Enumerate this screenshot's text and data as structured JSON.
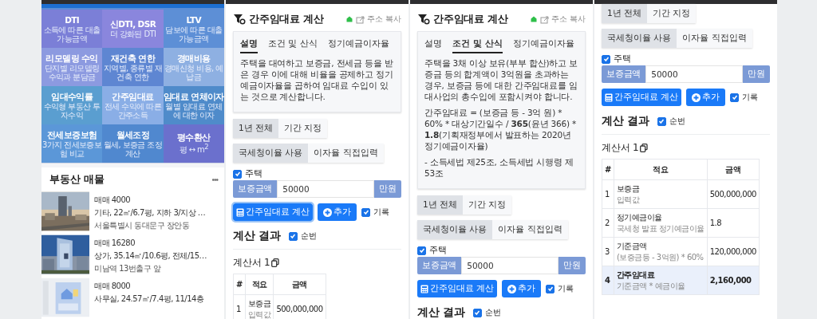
{
  "screens": [
    {
      "blocks": [
        {
          "kind": "tile_grid",
          "tiles": [
            {
              "title": "DTI",
              "subtitle": "소득에 따른 대출 가능금액",
              "color": "#7b7fd7"
            },
            {
              "title": "신DTI, DSR",
              "subtitle": "더 강화된 DTI",
              "color": "#8a86dd"
            },
            {
              "title": "LTV",
              "subtitle": "담보에 따른 대출 가능금액",
              "color": "#5d8fd6"
            },
            {
              "title": "리모델링 수익",
              "subtitle": "단지별 리모델링 수익과 분담금",
              "color": "#8c9ae0"
            },
            {
              "title": "재건축 연한",
              "subtitle": "지역별, 종류별 재건축 연한",
              "color": "#5e86d2"
            },
            {
              "title": "경매비용",
              "subtitle": "경매신청 비용, 예납금",
              "color": "#8eb0e2"
            },
            {
              "title": "임대수익률",
              "subtitle": "수익형 부동산 투자수익",
              "color": "#5a9ed0"
            },
            {
              "title": "간주임대료",
              "subtitle": "전세 수익에 따른 간주소득",
              "color": "#8aaee6"
            },
            {
              "title": "임대료 연체이자",
              "subtitle": "월별 임대료 연체에 대한 이자",
              "color": "#4f8bca"
            },
            {
              "title": "전세보증보험",
              "subtitle": "3가지 전세보증보험 비교",
              "color": "#5b97d8"
            },
            {
              "title": "월세조정",
              "subtitle": "월세, 보증금 조정 계산",
              "color": "#5088cf"
            },
            {
              "title": "평수환산",
              "subtitle": "평 ↔ m$^{2}$",
              "color": "#6b70cd"
            }
          ]
        },
        {
          "kind": "listings",
          "title": "부동산 매물",
          "more": "•••",
          "items": [
            {
              "price": "매매 4000",
              "detail": "기타, 22㎡/6.7평, 지하 3/지상 …",
              "location": "서울특별시 동대문구 장안동"
            },
            {
              "price": "매매 16280",
              "detail": "상가, 35.14㎡/10.6평, 전체/15…",
              "location": "미남역 13번출구 앞"
            },
            {
              "price": "매매 8000",
              "detail": "사무실, 24.57㎡/7.4평, 11/14층"
            }
          ]
        }
      ]
    },
    {
      "blocks": [
        {
          "kind": "header",
          "title": "간주임대료 계산",
          "link": "주소 복사"
        },
        {
          "kind": "tabcard",
          "tabs": [
            {
              "label": "설명",
              "selected": true
            },
            {
              "label": "조건 및 산식",
              "selected": false
            },
            {
              "label": "정기예금이자율",
              "selected": false
            }
          ],
          "paragraphs": [
            "주택을 대여하고 보증금, 전세금 등을 받은 경우 이에 대해 비율을 공제하고 정기예금이자율을 곱하여 임대료 수입이 있는 것으로 계산합니다."
          ]
        },
        {
          "kind": "segmented",
          "options": [
            {
              "label": "1년 전체",
              "selected": true
            },
            {
              "label": "기간 지정",
              "selected": false
            }
          ]
        },
        {
          "kind": "segmented",
          "options": [
            {
              "label": "국세청이율 사용",
              "selected": true
            },
            {
              "label": "이자율 직접입력",
              "selected": false
            }
          ]
        },
        {
          "kind": "checkbox",
          "label": "주택",
          "checked": true
        },
        {
          "kind": "input_group",
          "prefix": "보증금액",
          "value": "50000",
          "suffix": "만원"
        },
        {
          "kind": "actions",
          "primary": "간주임대료 계산",
          "focused": true,
          "add": "추가",
          "record": {
            "label": "기록",
            "checked": true
          }
        },
        {
          "kind": "result_heading",
          "title": "계산 결과",
          "toggle": {
            "label": "순번",
            "checked": true
          }
        },
        {
          "kind": "statement",
          "title": "계산서 1",
          "columns": [
            "#",
            "적요",
            "금액"
          ],
          "rows": [
            {
              "num": "1",
              "item": "보증금",
              "note": "입력값",
              "amount": "500,000,000",
              "highlighted": false
            }
          ]
        }
      ]
    },
    {
      "blocks": [
        {
          "kind": "header",
          "title": "간주임대료 계산",
          "link": "주소 복사"
        },
        {
          "kind": "tabcard",
          "tabs": [
            {
              "label": "설명",
              "selected": false
            },
            {
              "label": "조건 및 산식",
              "selected": true
            },
            {
              "label": "정기예금이자율",
              "selected": false
            }
          ],
          "paragraphs": [
            "주택을 3채 이상 보유(부부 합산)하고 보증금 등의 합계액이 3억원을 초과하는 경우, 보증금 등에 대한 간주임대료를 임대사업의 총수입에 포함시켜야 합니다.",
            "간주임대료 = (보증금 등 - 3억 원) * 60% * 대상기간일수 / **365**(윤년 366) * **1.8**(기획재정부에서 발표하는 2020년 정기예금이자율)",
            "- 소득세법 제25조, 소득세법 시행령 제53조"
          ]
        },
        {
          "kind": "segmented",
          "options": [
            {
              "label": "1년 전체",
              "selected": true
            },
            {
              "label": "기간 지정",
              "selected": false
            }
          ]
        },
        {
          "kind": "segmented",
          "options": [
            {
              "label": "국세청이율 사용",
              "selected": true
            },
            {
              "label": "이자율 직접입력",
              "selected": false
            }
          ]
        },
        {
          "kind": "checkbox",
          "label": "주택",
          "checked": true
        },
        {
          "kind": "input_group",
          "prefix": "보증금액",
          "value": "50000",
          "suffix": "만원"
        },
        {
          "kind": "actions",
          "primary": "간주임대료 계산",
          "focused": false,
          "add": "추가",
          "record": {
            "label": "기록",
            "checked": true
          }
        },
        {
          "kind": "result_heading",
          "title": "계산 결과",
          "toggle": {
            "label": "순번",
            "checked": true
          }
        }
      ]
    },
    {
      "blocks": [
        {
          "kind": "segmented",
          "options": [
            {
              "label": "1년 전체",
              "selected": true
            },
            {
              "label": "기간 지정",
              "selected": false
            }
          ]
        },
        {
          "kind": "segmented",
          "options": [
            {
              "label": "국세청이율 사용",
              "selected": true
            },
            {
              "label": "이자율 직접입력",
              "selected": false
            }
          ]
        },
        {
          "kind": "checkbox",
          "label": "주택",
          "checked": true
        },
        {
          "kind": "input_group",
          "prefix": "보증금액",
          "value": "50000",
          "suffix": "만원"
        },
        {
          "kind": "actions",
          "primary": "간주임대료 계산",
          "focused": false,
          "add": "추가",
          "record": {
            "label": "기록",
            "checked": true
          }
        },
        {
          "kind": "result_heading",
          "title": "계산 결과",
          "toggle": {
            "label": "순번",
            "checked": true
          }
        },
        {
          "kind": "statement",
          "title": "계산서 1",
          "columns": [
            "#",
            "적요",
            "금액"
          ],
          "rows": [
            {
              "num": "1",
              "item": "보증금",
              "note": "입력값",
              "amount": "500,000,000",
              "highlighted": false
            },
            {
              "num": "2",
              "item": "정기예금이율",
              "note": "국세청 발표 정기예금이율",
              "amount": "1.8",
              "highlighted": false
            },
            {
              "num": "3",
              "item": "기준금액",
              "note": "(보증금등 - 3억원) * 60%",
              "amount": "120,000,000",
              "highlighted": false
            },
            {
              "num": "4",
              "item": "간주임대료",
              "note": "기준금액 * 예금이율",
              "amount": "2,160,000",
              "highlighted": true
            }
          ]
        }
      ]
    }
  ]
}
